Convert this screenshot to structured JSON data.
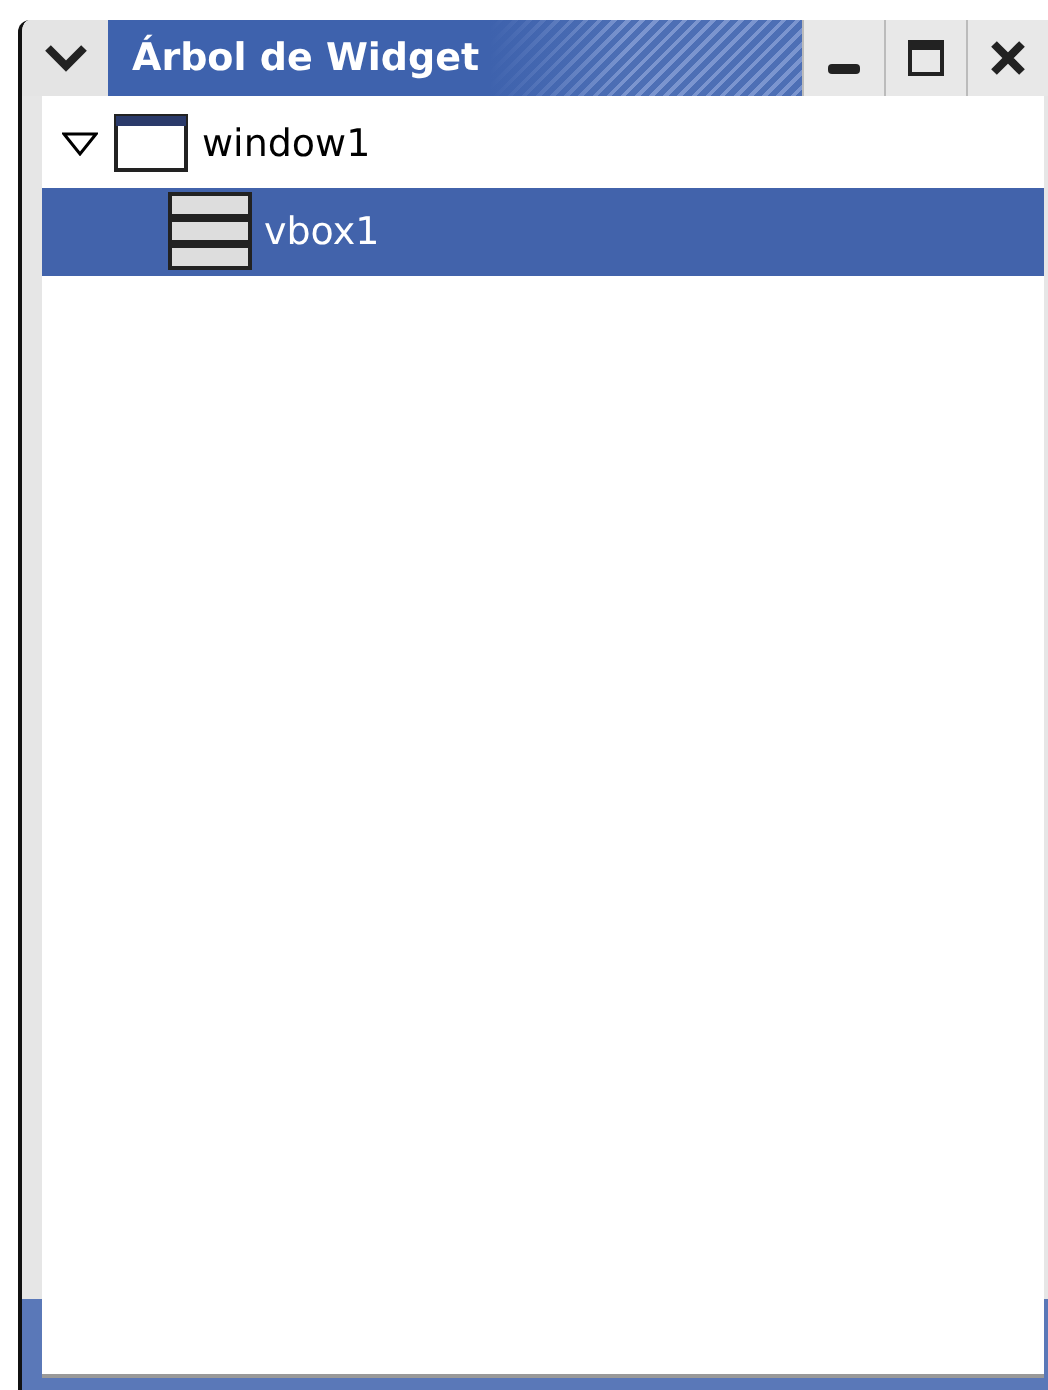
{
  "window": {
    "title": "Árbol de Widget"
  },
  "tree": [
    {
      "label": "window1",
      "kind": "window",
      "expanded": true,
      "selected": false,
      "children": [
        {
          "label": "vbox1",
          "kind": "vbox",
          "selected": true
        }
      ]
    }
  ]
}
